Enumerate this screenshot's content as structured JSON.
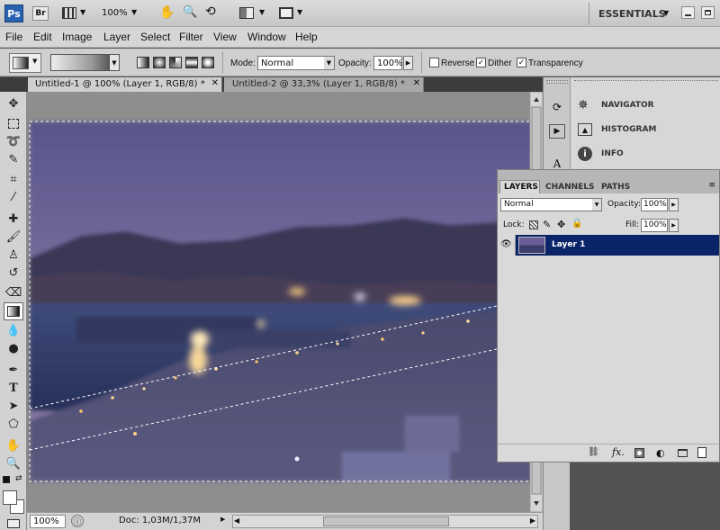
{
  "app": {
    "logo": "Ps",
    "bridge": "Br",
    "zoom_value": "100%",
    "workspace": "ESSENTIALS"
  },
  "icons": [
    "launch-bridge-icon",
    "view-extras-icon",
    "hand-icon",
    "zoom-icon",
    "rotate-view-icon",
    "arrange-documents-icon",
    "screen-mode-icon",
    "minimize-icon",
    "maximize-icon",
    "close-icon"
  ],
  "menu": [
    "File",
    "Edit",
    "Image",
    "Layer",
    "Select",
    "Filter",
    "View",
    "Window",
    "Help"
  ],
  "options": {
    "mode_label": "Mode:",
    "mode_value": "Normal",
    "opacity_label": "Opacity:",
    "opacity_value": "100%",
    "reverse": "Reverse",
    "dither": "Dither",
    "transparency": "Transparency",
    "reverse_checked": false,
    "dither_checked": true,
    "transparency_checked": true
  },
  "tabs": [
    {
      "label": "Untitled-1 @ 100% (Layer 1, RGB/8) *",
      "active": true
    },
    {
      "label": "Untitled-2 @ 33,3% (Layer 1, RGB/8) *",
      "active": false
    }
  ],
  "status": {
    "zoom": "100%",
    "doc": "Doc: 1,03M/1,37M"
  },
  "dock_panels": [
    {
      "label": "NAVIGATOR",
      "icon": "navigator-icon"
    },
    {
      "label": "HISTOGRAM",
      "icon": "histogram-icon"
    },
    {
      "label": "INFO",
      "icon": "info-icon"
    }
  ],
  "layers_panel": {
    "tabs": [
      "LAYERS",
      "CHANNELS",
      "PATHS"
    ],
    "blend_mode": "Normal",
    "opacity_label": "Opacity:",
    "opacity_value": "100%",
    "lock_label": "Lock:",
    "fill_label": "Fill:",
    "fill_value": "100%",
    "layer_name": "Layer 1"
  },
  "colors": {
    "selection": "#0a246a",
    "workspace": "#535353",
    "panel": "#d9d9d9"
  }
}
